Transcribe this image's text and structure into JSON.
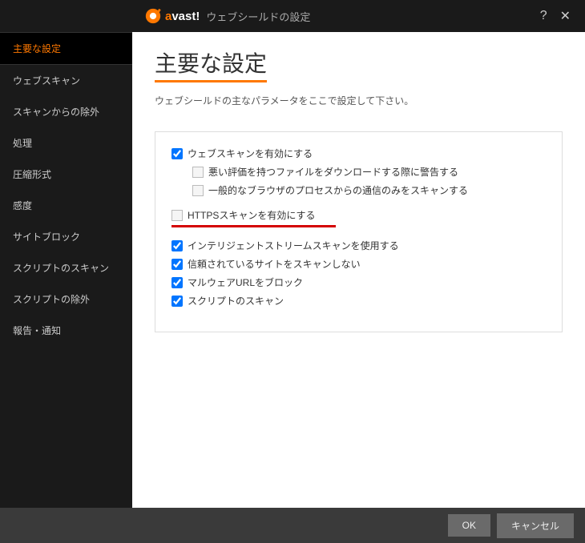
{
  "titlebar": {
    "brand_prefix": "a",
    "brand_rest": "vast!",
    "title": "ウェブシールドの設定"
  },
  "sidebar": {
    "items": [
      {
        "label": "主要な設定",
        "active": true
      },
      {
        "label": "ウェブスキャン",
        "active": false
      },
      {
        "label": "スキャンからの除外",
        "active": false
      },
      {
        "label": "処理",
        "active": false
      },
      {
        "label": "圧縮形式",
        "active": false
      },
      {
        "label": "感度",
        "active": false
      },
      {
        "label": "サイトブロック",
        "active": false
      },
      {
        "label": "スクリプトのスキャン",
        "active": false
      },
      {
        "label": "スクリプトの除外",
        "active": false
      },
      {
        "label": "報告・通知",
        "active": false
      }
    ]
  },
  "page": {
    "title": "主要な設定",
    "description": "ウェブシールドの主なパラメータをここで設定して下さい。"
  },
  "options": {
    "webscan_enable": {
      "label": "ウェブスキャンを有効にする",
      "checked": true
    },
    "warn_bad_download": {
      "label": "悪い評価を持つファイルをダウンロードする際に警告する",
      "checked": false
    },
    "scan_known_browsers": {
      "label": "一般的なブラウザのプロセスからの通信のみをスキャンする",
      "checked": false
    },
    "https_enable": {
      "label": "HTTPSスキャンを有効にする",
      "checked": false
    },
    "intelligent_stream": {
      "label": "インテリジェントストリームスキャンを使用する",
      "checked": true
    },
    "trusted_sites_skip": {
      "label": "信頼されているサイトをスキャンしない",
      "checked": true
    },
    "block_malware_url": {
      "label": "マルウェアURLをブロック",
      "checked": true
    },
    "script_scan": {
      "label": "スクリプトのスキャン",
      "checked": true
    }
  },
  "footer": {
    "ok": "OK",
    "cancel": "キャンセル"
  }
}
